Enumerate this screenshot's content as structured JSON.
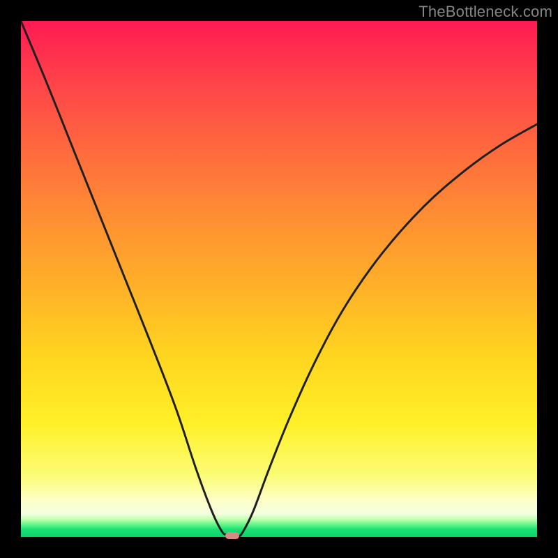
{
  "watermark": "TheBottleneck.com",
  "colors": {
    "frame": "#000000",
    "curve": "#202020",
    "bump": "#d88a84",
    "watermark": "#868686",
    "gradient_top": "#ff1a53",
    "gradient_bottom": "#0bd06e"
  },
  "chart_data": {
    "type": "line",
    "title": "",
    "xlabel": "",
    "ylabel": "",
    "xlim": [
      0,
      100
    ],
    "ylim": [
      0,
      100
    ],
    "grid": false,
    "series": [
      {
        "name": "bottleneck-curve",
        "x": [
          0,
          5,
          10,
          15,
          20,
          25,
          30,
          34,
          37,
          39,
          40,
          41,
          42,
          43,
          45,
          48,
          52,
          57,
          63,
          70,
          78,
          86,
          93,
          100
        ],
        "values": [
          100,
          88,
          75.5,
          63,
          50.5,
          38,
          25,
          13,
          5,
          1,
          0.5,
          0,
          0,
          1,
          5,
          13,
          23,
          34,
          45,
          55,
          64,
          71,
          76,
          80
        ]
      }
    ],
    "annotations": [
      {
        "name": "marker-bump",
        "x": 41,
        "y": 0
      }
    ],
    "background": {
      "type": "vertical-gradient",
      "meaning": "bottleneck-severity",
      "stops": [
        {
          "pos": 0.0,
          "color": "#ff1a53"
        },
        {
          "pos": 0.52,
          "color": "#ffb228"
        },
        {
          "pos": 0.78,
          "color": "#fff028"
        },
        {
          "pos": 0.95,
          "color": "#feffc8"
        },
        {
          "pos": 1.0,
          "color": "#0bd06e"
        }
      ]
    }
  }
}
